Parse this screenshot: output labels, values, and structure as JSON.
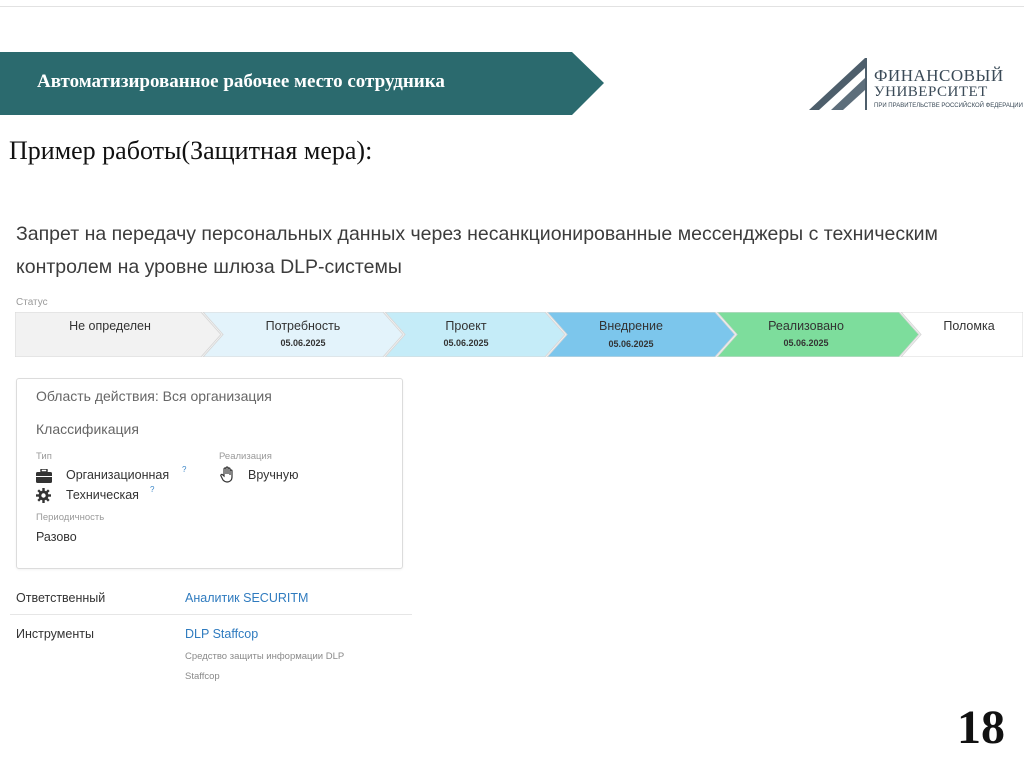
{
  "header": {
    "title": "Автоматизированное рабочее место сотрудника",
    "banner_color": "#2b6a6e"
  },
  "logo": {
    "line1": "ФИНАНСОВЫЙ",
    "line2": "УНИВЕРСИТЕТ",
    "sub": "ПРИ ПРАВИТЕЛЬСТВЕ РОССИЙСКОЙ ФЕДЕРАЦИИ"
  },
  "slide": {
    "heading": "Пример работы(Защитная мера):",
    "page_number": "18"
  },
  "measure": {
    "title": "Запрет на передачу персональных данных через несанкционированные мессенджеры с техническим контролем на уровне шлюза DLP-системы",
    "status_label": "Статус",
    "steps": [
      {
        "name": "Не определен",
        "date": "",
        "color": "#f2f2f2"
      },
      {
        "name": "Потребность",
        "date": "05.06.2025",
        "color": "#e3f3fb"
      },
      {
        "name": "Проект",
        "date": "05.06.2025",
        "color": "#c5ecf8"
      },
      {
        "name": "Внедрение",
        "date": "05.06.2025",
        "color": "#7cc6ec"
      },
      {
        "name": "Реализовано",
        "date": "05.06.2025",
        "color": "#7ddd9c"
      },
      {
        "name": "Поломка",
        "date": "",
        "color": "#ffffff"
      }
    ]
  },
  "card": {
    "scope": "Область действия: Вся организация",
    "classification_title": "Классификация",
    "type_label": "Тип",
    "types": [
      {
        "label": "Организационная",
        "icon": "briefcase-icon"
      },
      {
        "label": "Техническая",
        "icon": "gear-icon"
      }
    ],
    "help_mark": "?",
    "implementation_label": "Реализация",
    "implementation_value": "Вручную",
    "implementation_icon": "hand-icon",
    "periodicity_label": "Периодичность",
    "periodicity_value": "Разово"
  },
  "details": {
    "responsible_label": "Ответственный",
    "responsible_value": "Аналитик SECURITM",
    "tools_label": "Инструменты",
    "tool_name": "DLP Staffcop",
    "tool_desc_line1": "Средство защиты информации DLP",
    "tool_desc_line2": "Staffcop"
  }
}
